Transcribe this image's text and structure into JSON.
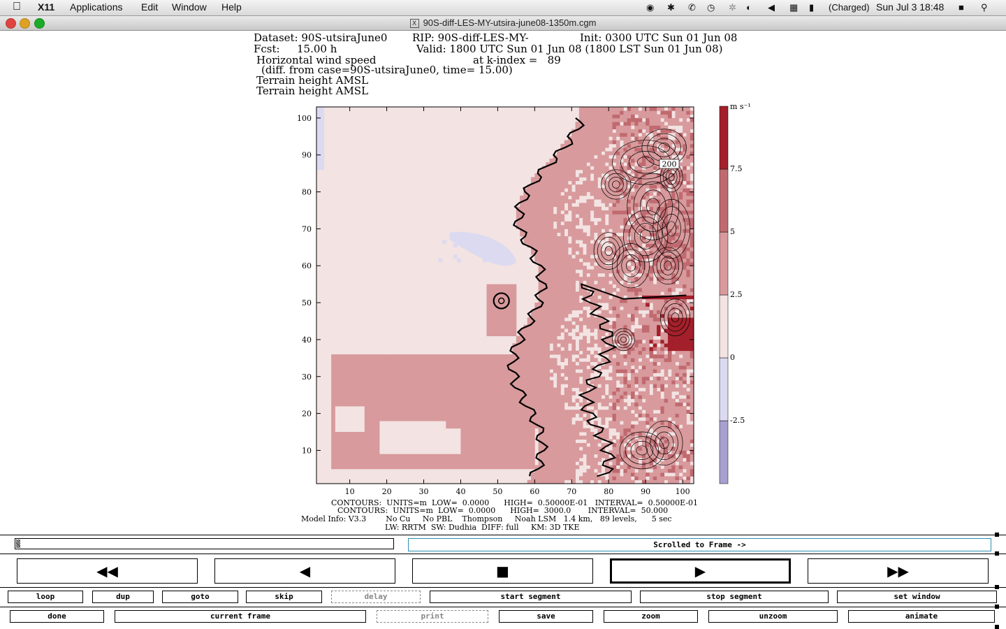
{
  "menubar": {
    "app_name": "X11",
    "menus": [
      "Applications",
      "Edit",
      "Window",
      "Help"
    ],
    "battery_text": "(Charged)",
    "clock": "Sun Jul 3  18:48"
  },
  "window": {
    "title": "90S-diff-LES-MY-utsira-june08-1350m.cgm"
  },
  "header": {
    "line1a": "Dataset: 90S-utsiraJune0",
    "line1b": "RIP: 90S-diff-LES-MY-",
    "line1c": "Init: 0300 UTC Sun 01 Jun 08",
    "line2a": "Fcst:",
    "line2b": "15.00 h",
    "line2c": "Valid: 1800 UTC Sun 01 Jun 08 (1800 LST Sun 01 Jun 08)",
    "line3a": "Horizontal wind speed",
    "line3b": "at k-index =   89",
    "line4": "(diff. from case=90S-utsiraJune0, time= 15.00)",
    "line5": "Terrain height AMSL",
    "line6": "Terrain height AMSL"
  },
  "chart_data": {
    "type": "heatmap",
    "title": "Horizontal wind speed",
    "x_ticks": [
      "10",
      "20",
      "30",
      "40",
      "50",
      "60",
      "70",
      "80",
      "90",
      "100"
    ],
    "y_ticks": [
      "10",
      "20",
      "30",
      "40",
      "50",
      "60",
      "70",
      "80",
      "90",
      "100"
    ],
    "xlim": [
      1,
      103
    ],
    "ylim": [
      1,
      103
    ],
    "colorbar_unit": "m s⁻¹",
    "colorbar_labels": [
      "7.5",
      "5",
      "2.5",
      "0",
      "-2.5"
    ],
    "colorbar_levels": [
      -5,
      -2.5,
      0,
      2.5,
      5,
      7.5,
      10
    ],
    "colorbar_colors": [
      "#a8a0cf",
      "#dcdaf0",
      "#f3e3e3",
      "#d89a9c",
      "#c06a70",
      "#a3202b"
    ],
    "contour_label": "200"
  },
  "footer": {
    "line1": "CONTOURS:  UNITS=m  LOW=  0.0000      HIGH=  0.50000E-01   INTERVAL=  0.50000E-01",
    "line2": "CONTOURS:  UNITS=m  LOW=  0.0000      HIGH=  3000.0       INTERVAL=  50.000",
    "line3": "Model Info: V3.3        No Cu     No PBL    Thompson     Noah LSM   1.4 km,   89 levels,      5 sec",
    "line4": "LW: RRTM  SW: Dudhia  DIFF: full     KM: 3D TKE"
  },
  "controls": {
    "status_text": "Scrolled to Frame ->",
    "row1": [
      "loop",
      "dup",
      "goto",
      "skip",
      "delay",
      "start segment",
      "stop segment",
      "set window"
    ],
    "row2": [
      "done",
      "current frame",
      "print",
      "save",
      "zoom",
      "unzoom",
      "animate"
    ]
  }
}
